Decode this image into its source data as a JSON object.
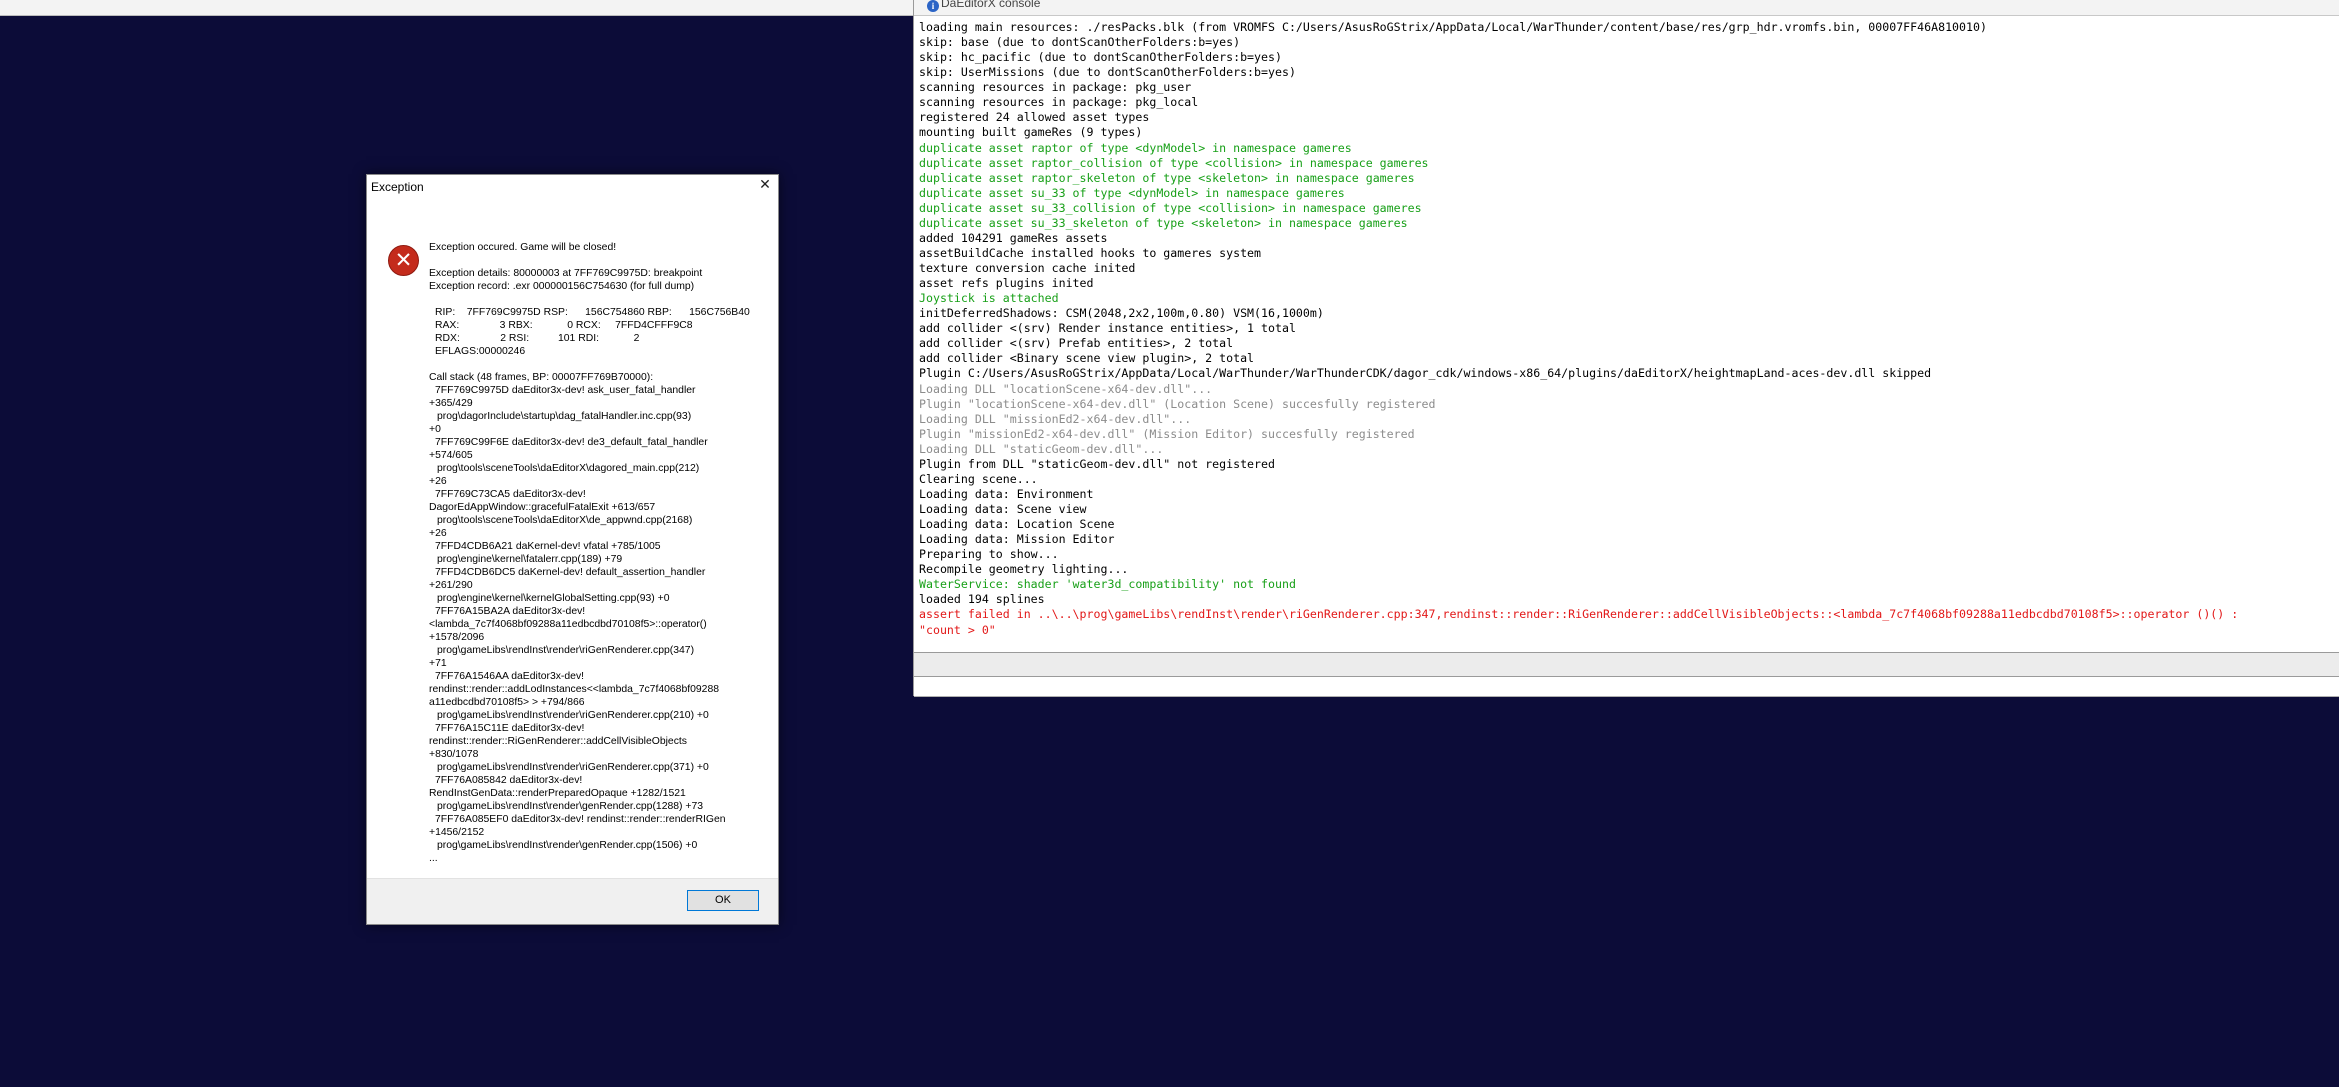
{
  "console": {
    "title": "DaEditorX console",
    "icon": "info-icon",
    "lines": [
      {
        "text": "loading main resources: ./resPacks.blk (from VROMFS C:/Users/AsusRoGStrix/AppData/Local/WarThunder/content/base/res/grp_hdr.vromfs.bin, 00007FF46A810010)",
        "color": "black"
      },
      {
        "text": "skip: base (due to dontScanOtherFolders:b=yes)",
        "color": "black"
      },
      {
        "text": "skip: hc_pacific (due to dontScanOtherFolders:b=yes)",
        "color": "black"
      },
      {
        "text": "skip: UserMissions (due to dontScanOtherFolders:b=yes)",
        "color": "black"
      },
      {
        "text": "scanning resources in package: pkg_user",
        "color": "black"
      },
      {
        "text": "scanning resources in package: pkg_local",
        "color": "black"
      },
      {
        "text": "registered 24 allowed asset types",
        "color": "black"
      },
      {
        "text": "mounting built gameRes (9 types)",
        "color": "black"
      },
      {
        "text": "duplicate asset raptor of type <dynModel> in namespace gameres",
        "color": "green"
      },
      {
        "text": "duplicate asset raptor_collision of type <collision> in namespace gameres",
        "color": "green"
      },
      {
        "text": "duplicate asset raptor_skeleton of type <skeleton> in namespace gameres",
        "color": "green"
      },
      {
        "text": "duplicate asset su_33 of type <dynModel> in namespace gameres",
        "color": "green"
      },
      {
        "text": "duplicate asset su_33_collision of type <collision> in namespace gameres",
        "color": "green"
      },
      {
        "text": "duplicate asset su_33_skeleton of type <skeleton> in namespace gameres",
        "color": "green"
      },
      {
        "text": "added 104291 gameRes assets",
        "color": "black"
      },
      {
        "text": "assetBuildCache installed hooks to gameres system",
        "color": "black"
      },
      {
        "text": "texture conversion cache inited",
        "color": "black"
      },
      {
        "text": "asset refs plugins inited",
        "color": "black"
      },
      {
        "text": "Joystick is attached",
        "color": "green"
      },
      {
        "text": "initDeferredShadows: CSM(2048,2x2,100m,0.80) VSM(16,1000m)",
        "color": "black"
      },
      {
        "text": "add collider <(srv) Render instance entities>, 1 total",
        "color": "black"
      },
      {
        "text": "add collider <(srv) Prefab entities>, 2 total",
        "color": "black"
      },
      {
        "text": "add collider <Binary scene view plugin>, 2 total",
        "color": "black"
      },
      {
        "text": "Plugin C:/Users/AsusRoGStrix/AppData/Local/WarThunder/WarThunderCDK/dagor_cdk/windows-x86_64/plugins/daEditorX/heightmapLand-aces-dev.dll skipped",
        "color": "black"
      },
      {
        "text": "Loading DLL \"locationScene-x64-dev.dll\"...",
        "color": "gray"
      },
      {
        "text": "Plugin \"locationScene-x64-dev.dll\" (Location Scene) succesfully registered",
        "color": "gray"
      },
      {
        "text": "Loading DLL \"missionEd2-x64-dev.dll\"...",
        "color": "gray"
      },
      {
        "text": "Plugin \"missionEd2-x64-dev.dll\" (Mission Editor) succesfully registered",
        "color": "gray"
      },
      {
        "text": "Loading DLL \"staticGeom-dev.dll\"...",
        "color": "gray"
      },
      {
        "text": "Plugin from DLL \"staticGeom-dev.dll\" not registered",
        "color": "black"
      },
      {
        "text": "Clearing scene...",
        "color": "black"
      },
      {
        "text": "Loading data: Environment",
        "color": "black"
      },
      {
        "text": "Loading data: Scene view",
        "color": "black"
      },
      {
        "text": "Loading data: Location Scene",
        "color": "black"
      },
      {
        "text": "Loading data: Mission Editor",
        "color": "black"
      },
      {
        "text": "Preparing to show...",
        "color": "black"
      },
      {
        "text": "Recompile geometry lighting...",
        "color": "black"
      },
      {
        "text": "WaterService: shader 'water3d_compatibility' not found",
        "color": "green"
      },
      {
        "text": "loaded 194 splines",
        "color": "black"
      },
      {
        "text": "assert failed in ..\\..\\prog\\gameLibs\\rendInst\\render\\riGenRenderer.cpp:347,rendinst::render::RiGenRenderer::addCellVisibleObjects::<lambda_7c7f4068bf09288a11edbcdbd70108f5>::operator ()() :",
        "color": "red"
      },
      {
        "text": "\"count > 0\"",
        "color": "red"
      }
    ]
  },
  "dialog": {
    "title": "Exception",
    "close_glyph": "✕",
    "error_icon_glyph": "✕",
    "message": "Exception occured. Game will be closed!",
    "details": "Exception details: 80000003 at 7FF769C9975D: breakpoint",
    "record": "Exception record: .exr 000000156C754630 (for full dump)",
    "registers": [
      "RIP:    7FF769C9975D RSP:      156C754860 RBP:      156C756B40",
      "RAX:              3 RBX:            0 RCX:     7FFD4CFFF9C8",
      "RDX:              2 RSI:          101 RDI:            2",
      "EFLAGS:00000246"
    ],
    "callstack_header": "Call stack (48 frames, BP: 00007FF769B70000):",
    "callstack": [
      {
        "entry": "7FF769C9975D daEditor3x-dev! ask_user_fatal_handler",
        "src": ""
      },
      {
        "entry": "+365/429",
        "src": "prog\\dagorInclude\\startup\\dag_fatalHandler.inc.cpp(93)"
      },
      {
        "entry": "+0",
        "src": ""
      },
      {
        "entry": "7FF769C99F6E daEditor3x-dev! de3_default_fatal_handler",
        "src": ""
      },
      {
        "entry": "+574/605",
        "src": "prog\\tools\\sceneTools\\daEditorX\\dagored_main.cpp(212)"
      },
      {
        "entry": "+26",
        "src": ""
      },
      {
        "entry": "7FF769C73CA5 daEditor3x-dev!",
        "src": ""
      },
      {
        "entry": "DagorEdAppWindow::gracefulFatalExit  +613/657",
        "src": "prog\\tools\\sceneTools\\daEditorX\\de_appwnd.cpp(2168)"
      },
      {
        "entry": "+26",
        "src": ""
      },
      {
        "entry": "7FFD4CDB6A21 daKernel-dev! vfatal  +785/1005",
        "src": "prog\\engine\\kernel\\fatalerr.cpp(189)  +79"
      },
      {
        "entry": "7FFD4CDB6DC5 daKernel-dev! default_assertion_handler",
        "src": ""
      },
      {
        "entry": "+261/290",
        "src": "prog\\engine\\kernel\\kernelGlobalSetting.cpp(93)  +0"
      },
      {
        "entry": "7FF76A15BA2A daEditor3x-dev!",
        "src": ""
      },
      {
        "entry": "<lambda_7c7f4068bf09288a11edbcdbd70108f5>::operator()",
        "src": ""
      },
      {
        "entry": "+1578/2096",
        "src": "prog\\gameLibs\\rendInst\\render\\riGenRenderer.cpp(347)"
      },
      {
        "entry": "+71",
        "src": ""
      },
      {
        "entry": "7FF76A1546AA daEditor3x-dev!",
        "src": ""
      },
      {
        "entry": "rendinst::render::addLodInstances<<lambda_7c7f4068bf09288",
        "src": ""
      },
      {
        "entry": "a11edbcdbd70108f5> >  +794/866",
        "src": "prog\\gameLibs\\rendInst\\render\\riGenRenderer.cpp(210)  +0"
      },
      {
        "entry": "7FF76A15C11E daEditor3x-dev!",
        "src": ""
      },
      {
        "entry": "rendinst::render::RiGenRenderer::addCellVisibleObjects",
        "src": ""
      },
      {
        "entry": "+830/1078",
        "src": "prog\\gameLibs\\rendInst\\render\\riGenRenderer.cpp(371)  +0"
      },
      {
        "entry": "7FF76A085842 daEditor3x-dev!",
        "src": ""
      },
      {
        "entry": "RendInstGenData::renderPreparedOpaque  +1282/1521",
        "src": "prog\\gameLibs\\rendInst\\render\\genRender.cpp(1288)  +73"
      },
      {
        "entry": "7FF76A085EF0 daEditor3x-dev! rendinst::render::renderRIGen",
        "src": ""
      },
      {
        "entry": "+1456/2152",
        "src": "prog\\gameLibs\\rendInst\\render\\genRender.cpp(1506)  +0"
      },
      {
        "entry": "...",
        "src": ""
      }
    ],
    "ok_label": "OK"
  }
}
